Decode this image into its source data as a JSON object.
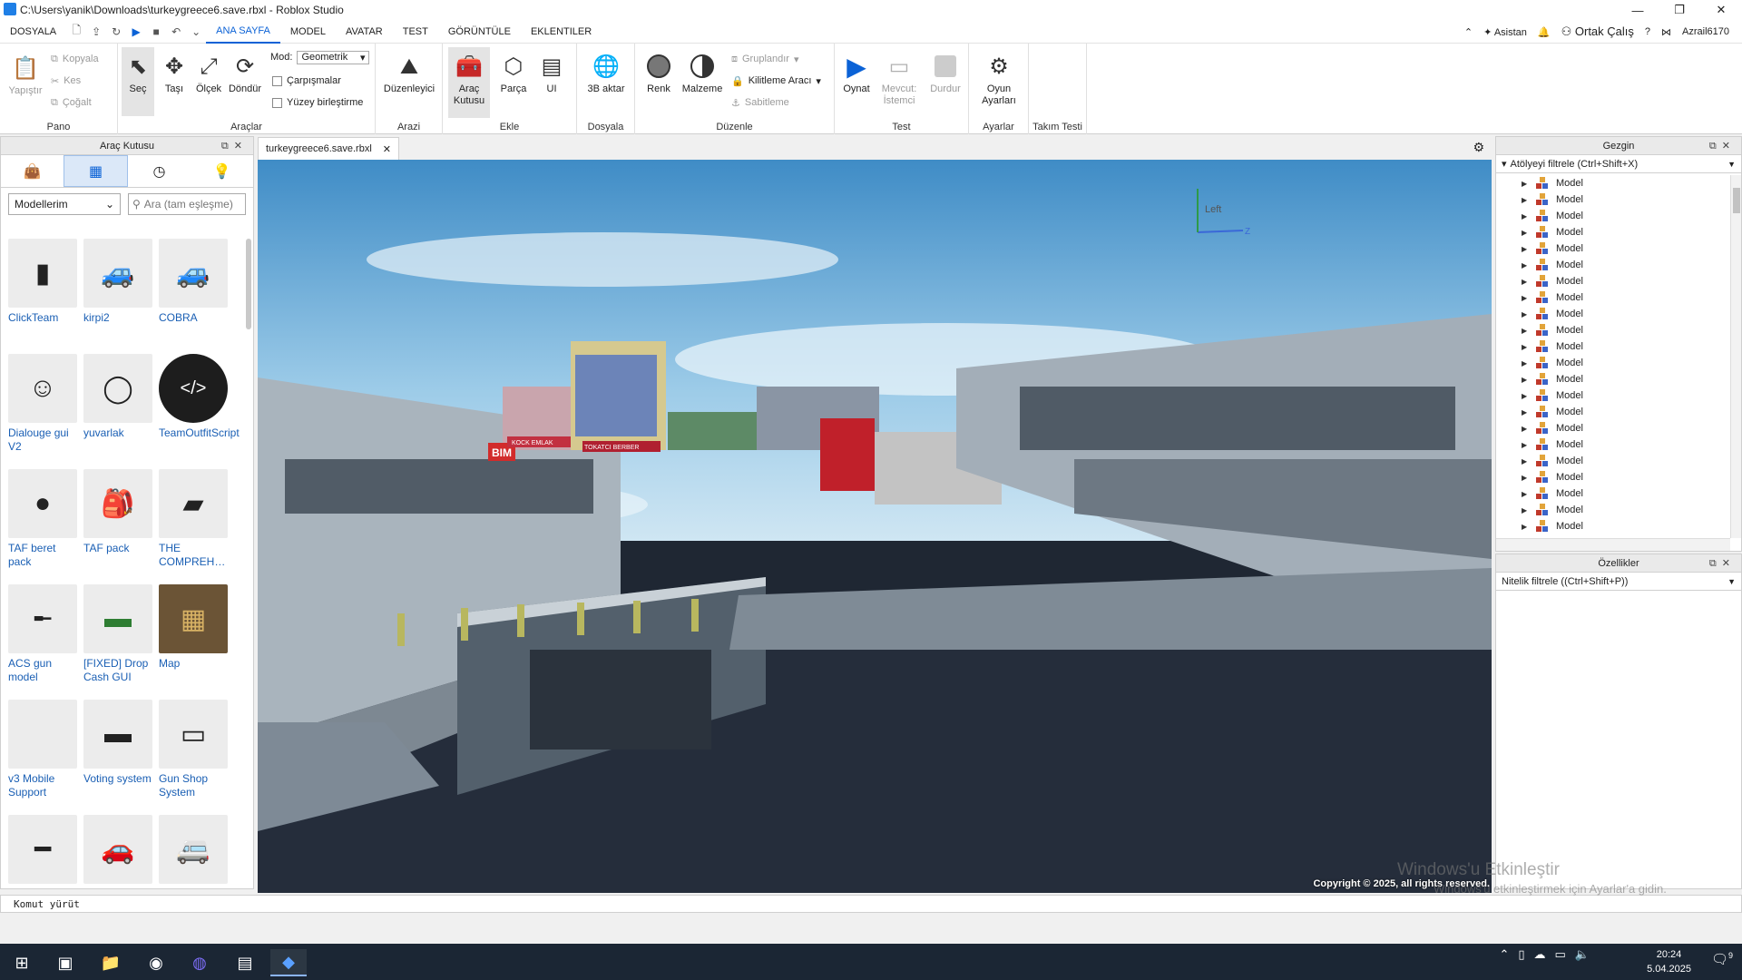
{
  "window": {
    "title": "C:\\Users\\yanik\\Downloads\\turkeygreece6.save.rbxl - Roblox Studio"
  },
  "menu": {
    "items": [
      "DOSYALA",
      "ANA SAYFA",
      "MODEL",
      "AVATAR",
      "TEST",
      "GÖRÜNTÜLE",
      "EKLENTILER"
    ],
    "active": "ANA SAYFA",
    "assistant": "Asistan",
    "collaborate": "Ortak Çalış",
    "username": "Azrail6170"
  },
  "ribbon": {
    "pano": {
      "label": "Pano",
      "paste": "Yapıştır",
      "copy": "Kopyala",
      "cut": "Kes",
      "duplicate": "Çoğalt"
    },
    "araclar": {
      "label": "Araçlar",
      "select": "Seç",
      "move": "Taşı",
      "scale": "Ölçek",
      "rotate": "Döndür",
      "mode_label": "Mod:",
      "mode_value": "Geometrik",
      "collisions": "Çarpışmalar",
      "surface_join": "Yüzey birleştirme"
    },
    "arazi": {
      "label": "Arazi",
      "editor": "Düzenleyici"
    },
    "ekle": {
      "label": "Ekle",
      "toolbox": "Araç Kutusu",
      "part": "Parça",
      "ui": "UI"
    },
    "dosyala": {
      "label": "Dosyala",
      "import3d": "3B aktar"
    },
    "duzenle": {
      "label": "Düzenle",
      "color": "Renk",
      "material": "Malzeme",
      "group": "Gruplandır",
      "lock": "Kilitleme Aracı",
      "anchor": "Sabitleme"
    },
    "test": {
      "label": "Test",
      "play": "Oynat",
      "current": "Mevcut:",
      "client": "İstemci",
      "stop": "Durdur"
    },
    "ayarlar": {
      "label": "Ayarlar",
      "game_settings": "Oyun Ayarları"
    },
    "takim": {
      "label": "Takım Testi"
    }
  },
  "toolbox": {
    "title": "Araç Kutusu",
    "category": "Modellerim",
    "search_placeholder": "Ara (tam eşleşme)",
    "items": [
      {
        "name": "ClickTeam",
        "icon": "grey-block"
      },
      {
        "name": "kirpi2",
        "icon": "vehicle"
      },
      {
        "name": "COBRA",
        "icon": "vehicle"
      },
      {
        "name": "Dialouge gui V2",
        "icon": "character"
      },
      {
        "name": "yuvarlak",
        "icon": "ring"
      },
      {
        "name": "TeamOutfitScript",
        "icon": "code"
      },
      {
        "name": "TAF beret pack",
        "icon": "berets"
      },
      {
        "name": "TAF pack",
        "icon": "gear"
      },
      {
        "name": "THE COMPREH…",
        "icon": "weapons"
      },
      {
        "name": "ACS gun model",
        "icon": "gun"
      },
      {
        "name": "[FIXED] Drop Cash GUI",
        "icon": "cash"
      },
      {
        "name": "Map",
        "icon": "map"
      },
      {
        "name": "v3 Mobile Support",
        "icon": "blank"
      },
      {
        "name": "Voting system",
        "icon": "screen"
      },
      {
        "name": "Gun Shop System",
        "icon": "shop"
      },
      {
        "name": "",
        "icon": "rifle"
      },
      {
        "name": "",
        "icon": "car"
      },
      {
        "name": "",
        "icon": "van"
      }
    ]
  },
  "document": {
    "tab": "turkeygreece6.save.rbxl",
    "view_cube_label": "Left",
    "axis_label": "Z",
    "copyright": "Copyright © 2025, all rights reserved.",
    "signs": [
      "BIM",
      "TOKATCI BERBER",
      "KOCK EMLAK"
    ]
  },
  "explorer": {
    "title": "Gezgin",
    "filter_placeholder": "Atölyeyi filtrele (Ctrl+Shift+X)",
    "rows": [
      "Model",
      "Model",
      "Model",
      "Model",
      "Model",
      "Model",
      "Model",
      "Model",
      "Model",
      "Model",
      "Model",
      "Model",
      "Model",
      "Model",
      "Model",
      "Model",
      "Model",
      "Model",
      "Model",
      "Model",
      "Model",
      "Model"
    ]
  },
  "properties": {
    "title": "Özellikler",
    "filter_placeholder": "Nitelik filtrele ((Ctrl+Shift+P))"
  },
  "command": {
    "placeholder": "Komut yürüt"
  },
  "os": {
    "activation_title": "Windows'u Etkinleştir",
    "activation_sub": "Windows'u etkinleştirmek için Ayarlar'a gidin.",
    "time": "20:24",
    "date": "5.04.2025",
    "notifications": "9"
  },
  "colors": {
    "accent": "#0b62d6",
    "taskbar": "#1b2634",
    "sky": "#6fb4e0",
    "asphalt": "#252d3b"
  }
}
